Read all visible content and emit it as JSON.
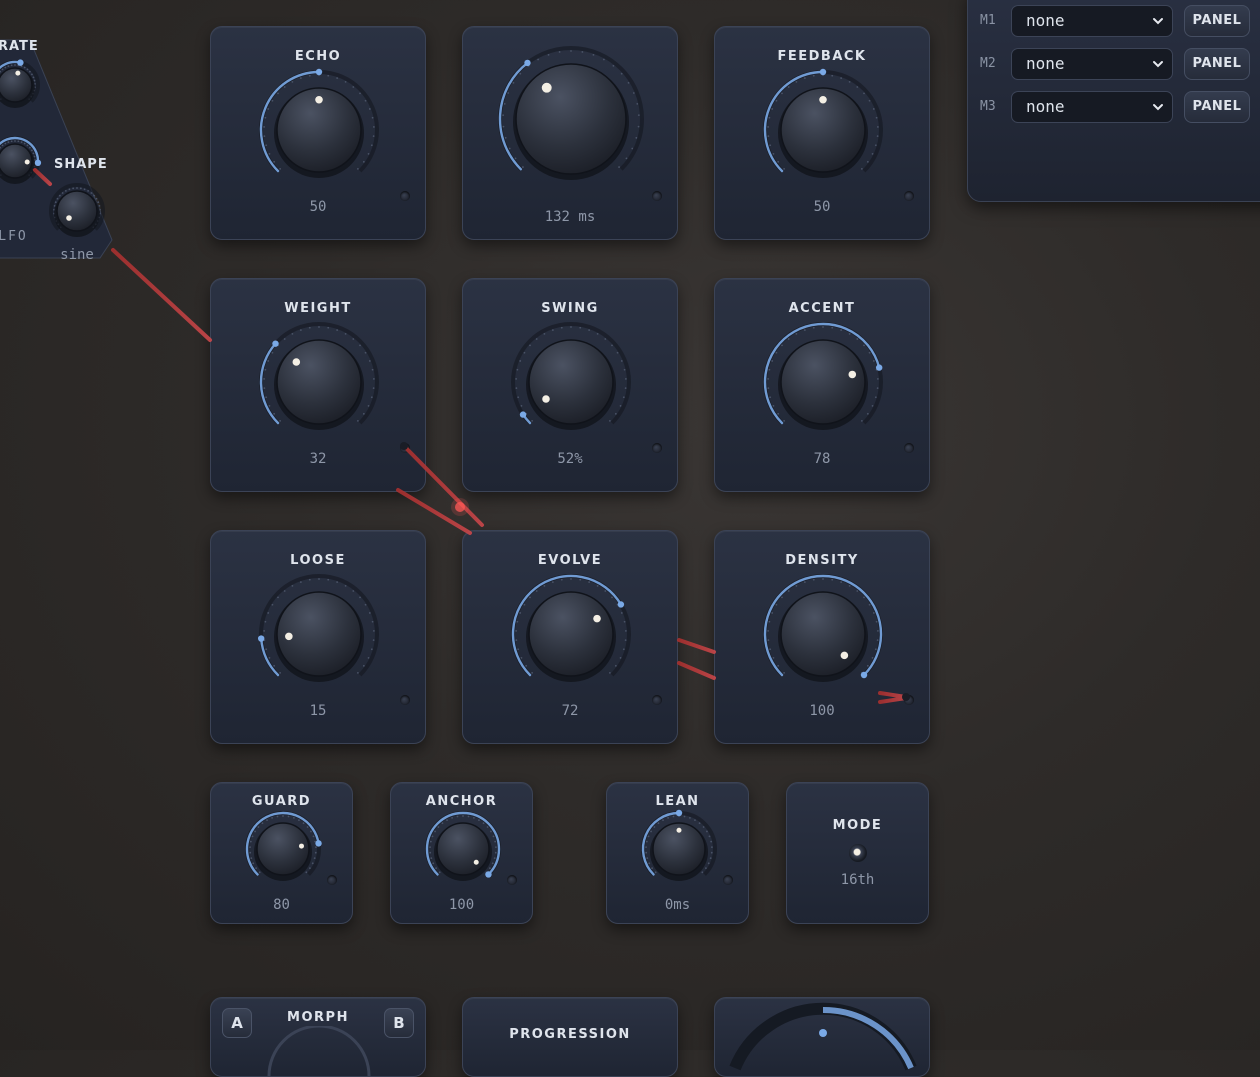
{
  "lfo": {
    "rate_label": "RATE",
    "shape_label": "SHAPE",
    "shape_value": "sine",
    "lfo_label": "LFO"
  },
  "modules": [
    {
      "id": "echo",
      "title": "ECHO",
      "value": "50",
      "level": 0.5
    },
    {
      "id": "time",
      "title": "",
      "value": "132 ms",
      "level": 0.36
    },
    {
      "id": "feedback",
      "title": "FEEDBACK",
      "value": "50",
      "level": 0.5
    },
    {
      "id": "weight",
      "title": "WEIGHT",
      "value": "32",
      "level": 0.32
    },
    {
      "id": "swing",
      "title": "SWING",
      "value": "52%",
      "level": 0.04
    },
    {
      "id": "accent",
      "title": "ACCENT",
      "value": "78",
      "level": 0.78
    },
    {
      "id": "loose",
      "title": "LOOSE",
      "value": "15",
      "level": 0.15
    },
    {
      "id": "evolve",
      "title": "EVOLVE",
      "value": "72",
      "level": 0.72
    },
    {
      "id": "density",
      "title": "DENSITY",
      "value": "100",
      "level": 1.0
    },
    {
      "id": "guard",
      "title": "GUARD",
      "value": "80",
      "level": 0.8
    },
    {
      "id": "anchor",
      "title": "ANCHOR",
      "value": "100",
      "level": 1.0
    },
    {
      "id": "lean",
      "title": "LEAN",
      "value": "0ms",
      "level": 0.5
    },
    {
      "id": "mode",
      "title": "MODE",
      "value": "16th"
    }
  ],
  "bottom": {
    "morph_title": "MORPH",
    "a_label": "A",
    "b_label": "B",
    "progression_title": "PROGRESSION"
  },
  "mod_slots": [
    {
      "label": "M1",
      "value": "none",
      "button": "PANEL"
    },
    {
      "label": "M2",
      "value": "none",
      "button": "PANEL"
    },
    {
      "label": "M3",
      "value": "none",
      "button": "PANEL"
    }
  ],
  "colors": {
    "accent": "#7aa9e6",
    "cable": "#b8383a",
    "panel": "#232a39"
  }
}
